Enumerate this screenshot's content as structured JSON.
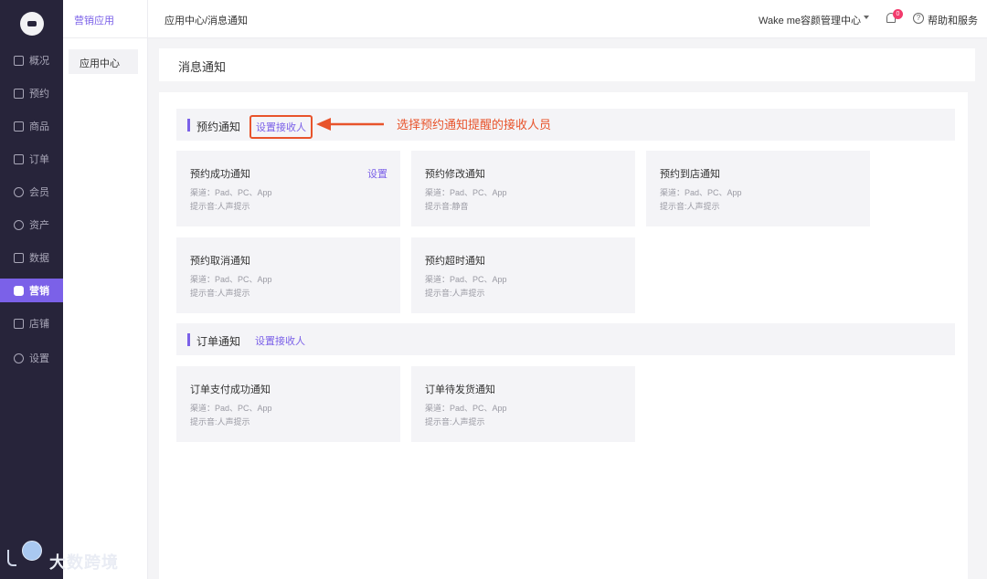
{
  "nav": {
    "items": [
      {
        "label": "概况",
        "icon": "monitor-icon"
      },
      {
        "label": "预约",
        "icon": "calendar-icon"
      },
      {
        "label": "商品",
        "icon": "bag-icon"
      },
      {
        "label": "订单",
        "icon": "list-icon"
      },
      {
        "label": "会员",
        "icon": "user-icon"
      },
      {
        "label": "资产",
        "icon": "coin-icon"
      },
      {
        "label": "数据",
        "icon": "chart-icon"
      },
      {
        "label": "营销",
        "icon": "grid-icon",
        "active": true
      },
      {
        "label": "店铺",
        "icon": "store-icon"
      },
      {
        "label": "设置",
        "icon": "gear-icon"
      }
    ]
  },
  "subnav": {
    "title": "营销应用",
    "items": [
      {
        "label": "应用中心"
      }
    ]
  },
  "header": {
    "breadcrumb": "应用中心/消息通知",
    "store_name": "Wake me容颜管理中心",
    "notification_count": "0",
    "help_label": "帮助和服务"
  },
  "page": {
    "title": "消息通知"
  },
  "sections": [
    {
      "title": "预约通知",
      "link": "设置接收人",
      "cards": [
        {
          "title": "预约成功通知",
          "action": "设置",
          "channel": "渠道：Pad、PC、App",
          "sound": "提示音:人声提示"
        },
        {
          "title": "预约修改通知",
          "channel": "渠道：Pad、PC、App",
          "sound": "提示音:静音"
        },
        {
          "title": "预约到店通知",
          "channel": "渠道：Pad、PC、App",
          "sound": "提示音:人声提示"
        },
        {
          "title": "预约取消通知",
          "channel": "渠道：Pad、PC、App",
          "sound": "提示音:人声提示"
        },
        {
          "title": "预约超时通知",
          "channel": "渠道：Pad、PC、App",
          "sound": "提示音:人声提示"
        }
      ]
    },
    {
      "title": "订单通知",
      "link": "设置接收人",
      "cards": [
        {
          "title": "订单支付成功通知",
          "channel": "渠道：Pad、PC、App",
          "sound": "提示音:人声提示"
        },
        {
          "title": "订单待发货通知",
          "channel": "渠道：Pad、PC、App",
          "sound": "提示音:人声提示"
        }
      ]
    }
  ],
  "annotation": {
    "text": "选择预约通知提醒的接收人员",
    "color": "#e8532b"
  },
  "watermark": {
    "text": "大数跨境"
  },
  "colors": {
    "accent": "#7b61e8",
    "nav_bg": "#27243a",
    "badge": "#f23b6c"
  }
}
